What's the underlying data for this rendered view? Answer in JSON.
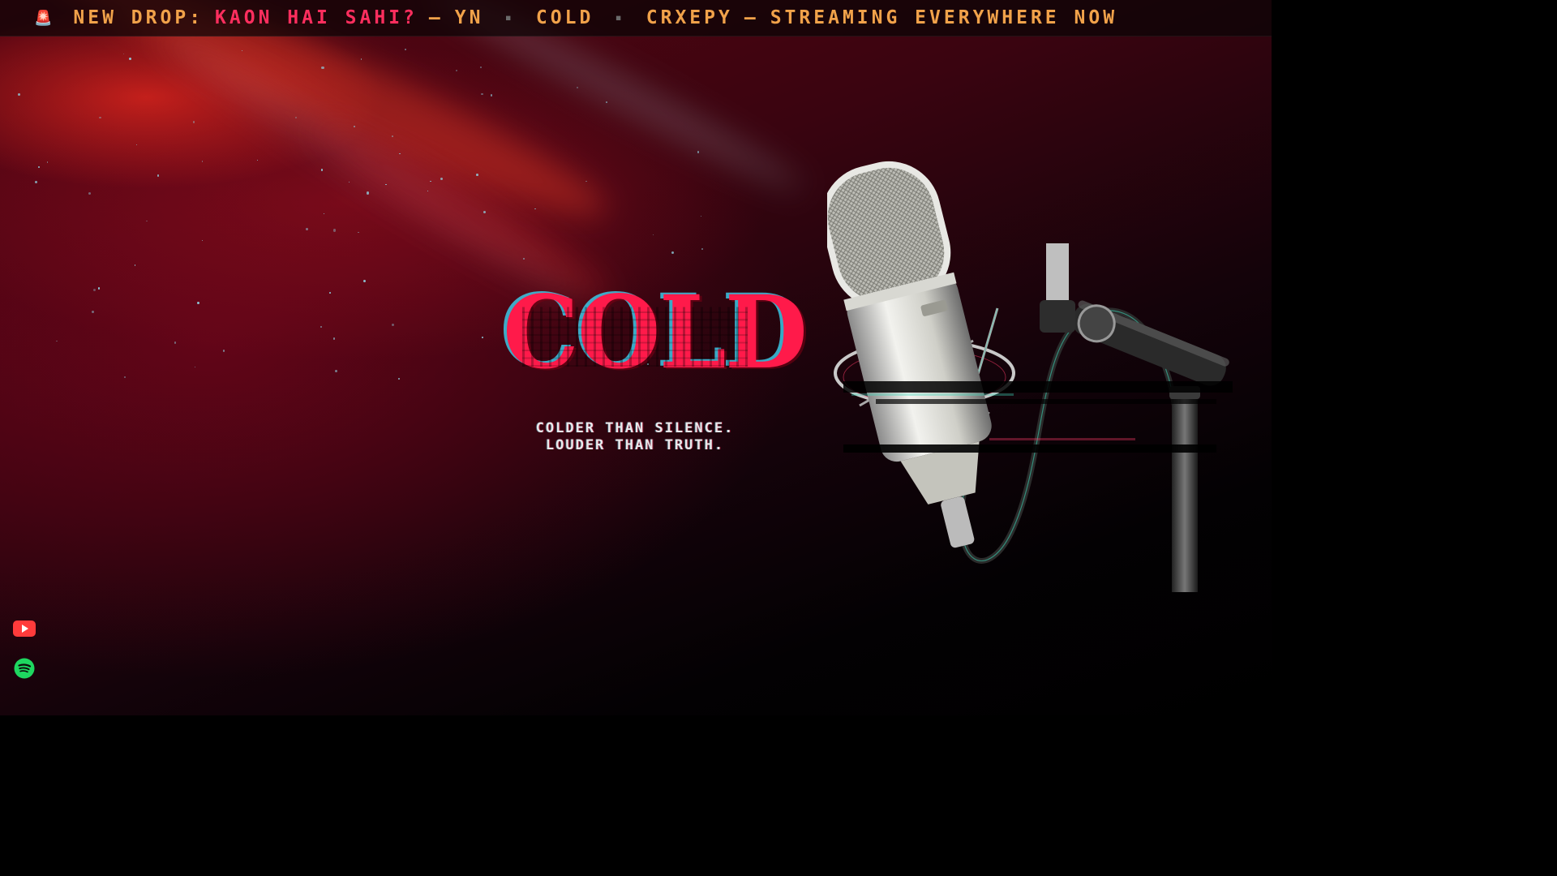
{
  "ticker": {
    "siren_icon": "rotating-light-icon",
    "prefix": "NEW DROP:",
    "track": "KAON HAI SAHI?",
    "dash1": "—",
    "artist1": "YN",
    "separator": "▪",
    "artist2": "COLD",
    "artist3": "CRXEPY",
    "dash2": "—",
    "status": "STREAMING EVERYWHERE NOW"
  },
  "hero": {
    "title": "COLD",
    "tagline_line1": "COLDER THAN SILENCE.",
    "tagline_line2": "LOUDER THAN TRUTH."
  },
  "social": {
    "youtube_icon": "youtube-icon",
    "spotify_icon": "spotify-icon"
  },
  "colors": {
    "accent_red": "#ff1a4a",
    "ticker_orange": "#f1a24a",
    "youtube_red": "#ff3b3b",
    "spotify_green": "#1ed760",
    "glitch_cyan": "#3cc8e6"
  }
}
